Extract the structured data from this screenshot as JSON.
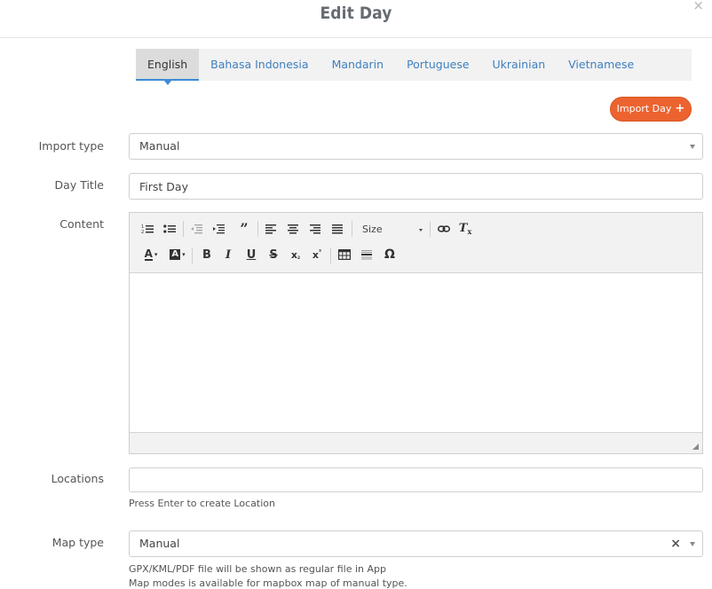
{
  "modal": {
    "title": "Edit Day",
    "close_glyph": "×"
  },
  "tabs": [
    {
      "label": "English",
      "active": true
    },
    {
      "label": "Bahasa Indonesia",
      "active": false
    },
    {
      "label": "Mandarin",
      "active": false
    },
    {
      "label": "Portuguese",
      "active": false
    },
    {
      "label": "Ukrainian",
      "active": false
    },
    {
      "label": "Vietnamese",
      "active": false
    }
  ],
  "import_button": {
    "label": "Import Day",
    "icon": "plus-icon",
    "color": "#ec6330"
  },
  "form": {
    "import_type": {
      "label": "Import type",
      "value": "Manual"
    },
    "day_title": {
      "label": "Day Title",
      "value": "First Day"
    },
    "content": {
      "label": "Content"
    },
    "locations": {
      "label": "Locations",
      "value": "",
      "help": "Press Enter to create Location"
    },
    "map_type": {
      "label": "Map type",
      "value": "Manual",
      "help_lines": [
        "GPX/KML/PDF file will be shown as regular file in App",
        "Map modes is available for mapbox map of manual type."
      ]
    }
  },
  "editor_toolbar": {
    "size_label": "Size",
    "row1_icons": [
      "numbered-list-icon",
      "bulleted-list-icon",
      "outdent-icon",
      "indent-icon",
      "blockquote-icon",
      "align-left-icon",
      "align-center-icon",
      "align-right-icon",
      "justify-icon",
      "link-icon",
      "remove-format-icon"
    ],
    "row2_icons": [
      "text-color-icon",
      "background-color-icon",
      "bold-icon",
      "italic-icon",
      "underline-icon",
      "strikethrough-icon",
      "subscript-icon",
      "superscript-icon",
      "table-icon",
      "horizontal-line-icon",
      "special-char-icon"
    ]
  },
  "colors": {
    "accent_blue": "#3d8bd6",
    "link_blue": "#3f7fbf",
    "import_orange": "#ec6330"
  }
}
